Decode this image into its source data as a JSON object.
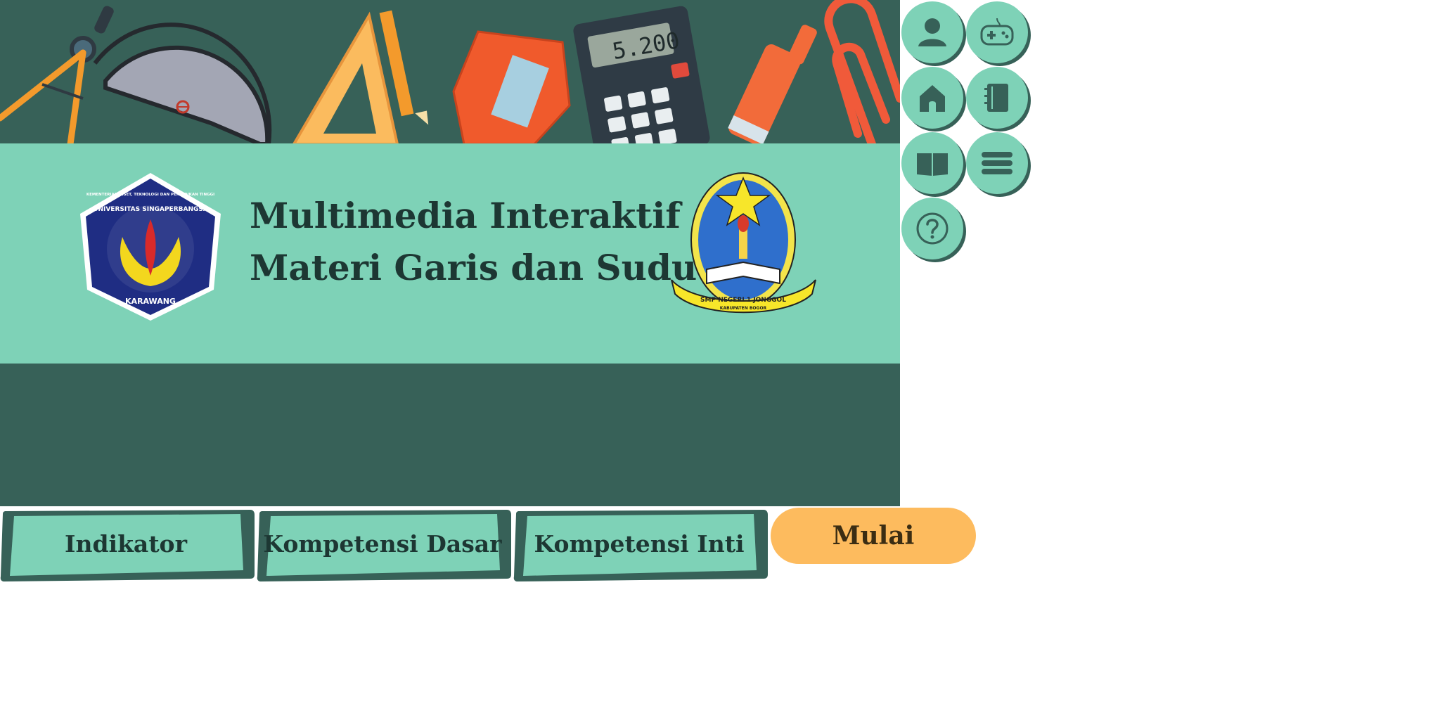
{
  "app": {
    "title_line1": "Multimedia Interaktif",
    "title_line2": "Materi Garis dan Sudut"
  },
  "logos": {
    "left": {
      "name": "Universitas Singaperbangsa Karawang",
      "ring_text": "KEMENTERIAN RISET, TEKNOLOGI DAN PENDIDIKAN TINGGI",
      "arc_text": "UNIVERSITAS SINGAPERBANGSA",
      "bottom_text": "KARAWANG"
    },
    "right": {
      "name": "SMP Negeri 1 Jonggol",
      "ribbon_text": "SMP NEGERI 1 JONGGOL",
      "ribbon_sub": "KABUPATEN BOGOR"
    }
  },
  "illustration": {
    "calculator_display": "5.200"
  },
  "side_menu": [
    {
      "icon": "user-icon",
      "label": ""
    },
    {
      "icon": "gamepad-icon",
      "label": ""
    },
    {
      "icon": "home-icon",
      "label": ""
    },
    {
      "icon": "notebook-icon",
      "label": ""
    },
    {
      "icon": "book-icon",
      "label": ""
    },
    {
      "icon": "menu-icon",
      "label": ""
    },
    {
      "icon": "help-icon",
      "label": ""
    }
  ],
  "tabs": [
    {
      "label": "Indikator"
    },
    {
      "label": "Kompetensi Dasar"
    },
    {
      "label": "Kompetensi Inti"
    }
  ],
  "start_button": {
    "label": "Mulai"
  },
  "colors": {
    "dark_green": "#376158",
    "mint": "#7ed2b7",
    "orange": "#fdbb5e",
    "text_dark": "#1d3733"
  }
}
